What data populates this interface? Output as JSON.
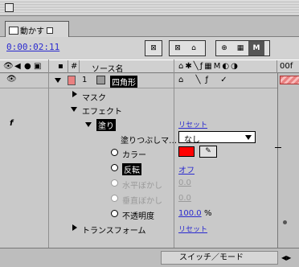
{
  "window": {
    "tab_label": "動かす"
  },
  "toolbar": {
    "timecode": "0:00:02:11"
  },
  "columns": {
    "hash": "#",
    "source_name": "ソース名",
    "timeline_label": "00f"
  },
  "layer": {
    "number": "1",
    "name": "四角形",
    "label_color": "#e98080"
  },
  "items": {
    "mask": "マスク",
    "effect": "エフェクト",
    "fill": "塗り",
    "fill_reset": "リセット",
    "fill_mask_label": "塗りつぶしマ…",
    "fill_mask_value": "なし",
    "color_label": "カラー",
    "color_value": "#ff0000",
    "invert_label": "反転",
    "invert_value": "オフ",
    "hfeather_label": "水平ぼかし",
    "hfeather_value": "0.0",
    "vfeather_label": "垂直ぼかし",
    "vfeather_value": "0.0",
    "opacity_label": "不透明度",
    "opacity_value": "100.0",
    "opacity_unit": "%",
    "transform": "トランスフォーム",
    "transform_reset": "リセット",
    "fx_icon": "f"
  },
  "bottom": {
    "mode_toggle": "スイッチ／モード"
  },
  "icons": [
    "eye-icon",
    "speaker-icon",
    "solo-icon",
    "lock-icon",
    "stopwatch-icon",
    "eyedropper-icon",
    "effect-fx-icon"
  ]
}
